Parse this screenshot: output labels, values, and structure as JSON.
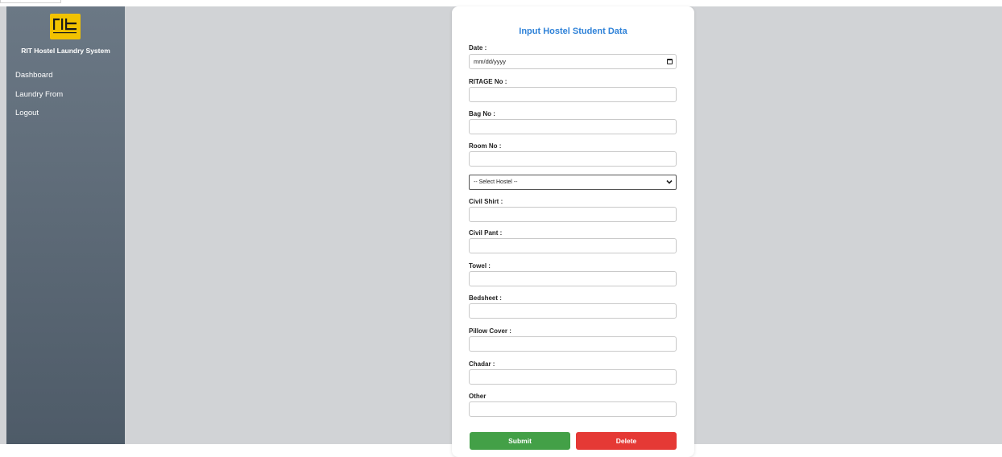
{
  "sidebar": {
    "logo_text": "rit",
    "brand": "RIT Hostel Laundry System",
    "items": [
      {
        "label": "Dashboard"
      },
      {
        "label": "Laundry From"
      },
      {
        "label": "Logout"
      }
    ]
  },
  "form": {
    "title": "Input Hostel Student Data",
    "date_label": "Date :",
    "date_placeholder": "mm/dd/yyyy",
    "ritage_label": "RITAGE No :",
    "bag_label": "Bag No :",
    "room_label": "Room No :",
    "hostel_select": "-- Select Hostel --",
    "civil_shirt_label": "Civil Shirt :",
    "civil_pant_label": "Civil Pant :",
    "towel_label": "Towel :",
    "bedsheet_label": "Bedsheet :",
    "pillow_cover_label": "Pillow Cover :",
    "chadar_label": "Chadar :",
    "other_label": "Other",
    "submit_label": "Submit",
    "delete_label": "Delete"
  },
  "colors": {
    "title": "#2f82d8",
    "submit": "#43a047",
    "delete": "#e53935",
    "logo_bg": "#f2c200"
  }
}
